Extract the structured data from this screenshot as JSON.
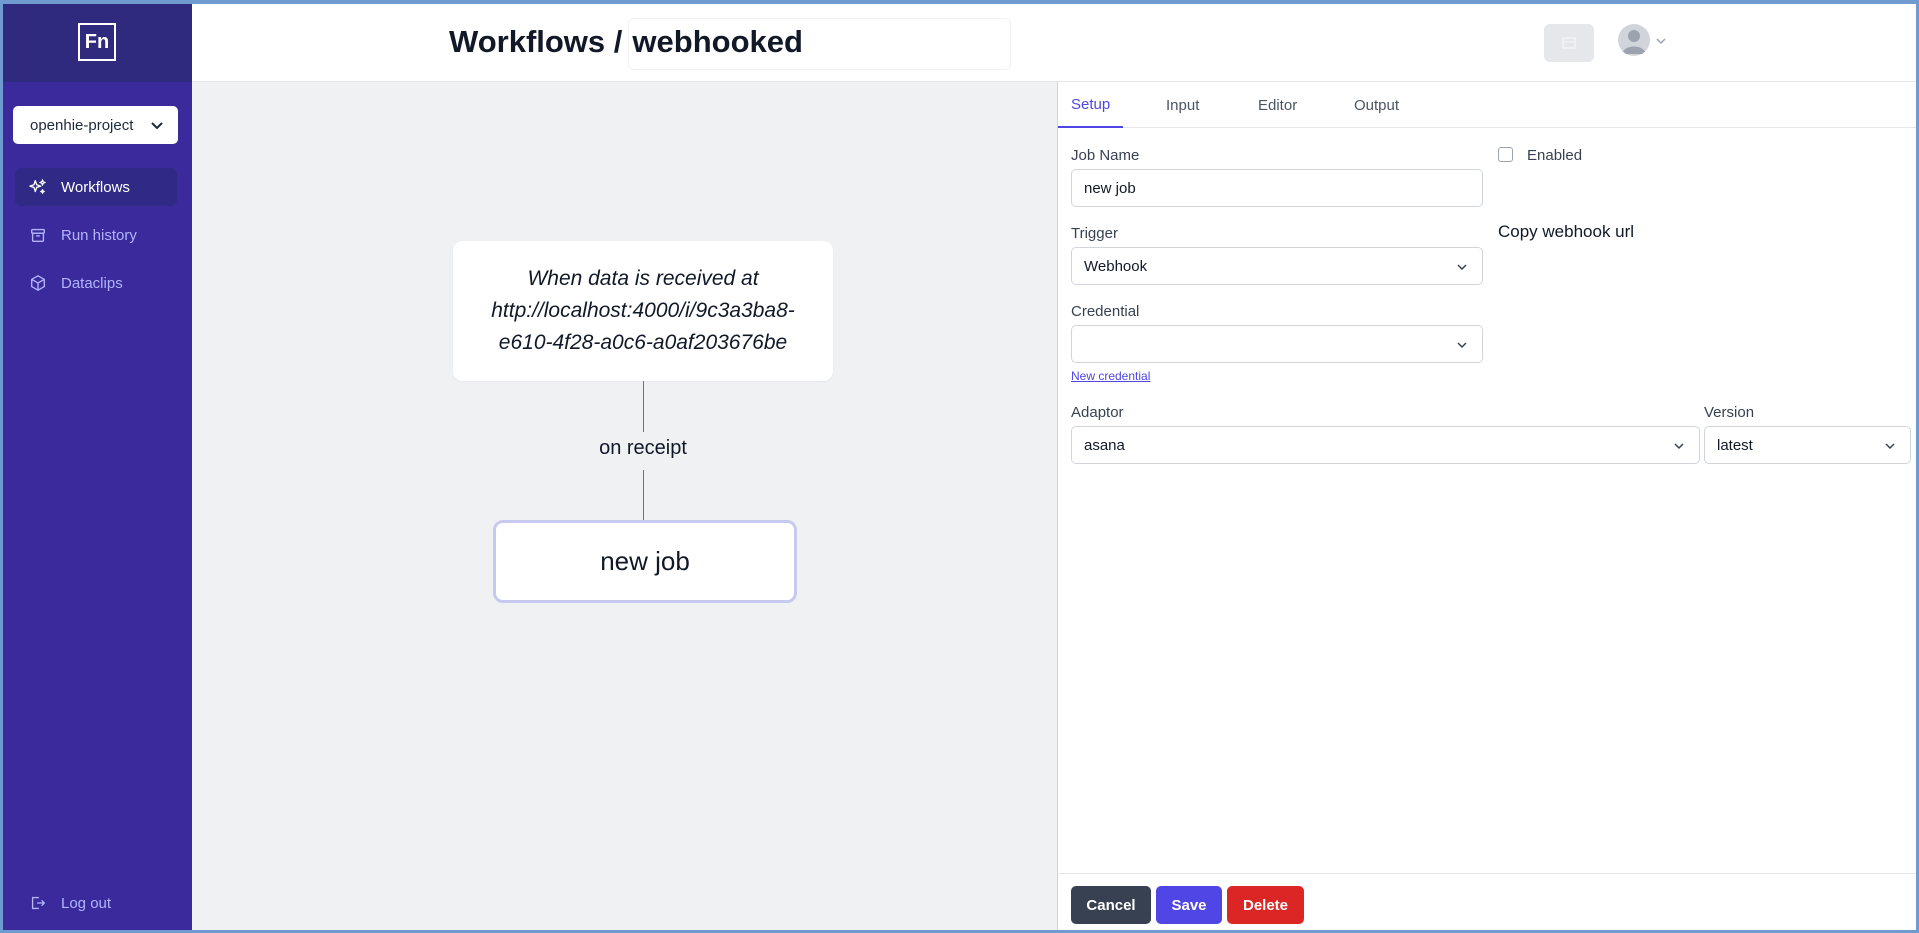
{
  "sidebar": {
    "logo": "Fn",
    "project": "openhie-project",
    "items": [
      {
        "label": "Workflows"
      },
      {
        "label": "Run history"
      },
      {
        "label": "Dataclips"
      }
    ],
    "logout": "Log out"
  },
  "header": {
    "breadcrumb": "Workflows /",
    "workflow_name": "webhooked"
  },
  "canvas": {
    "trigger_text": "When data is received at http://localhost:4000/i/9c3a3ba8-e610-4f28-a0c6-a0af203676be",
    "edge_label": "on receipt",
    "job_node": "new job"
  },
  "panel": {
    "tabs": [
      "Setup",
      "Input",
      "Editor",
      "Output"
    ],
    "active_tab": "Setup",
    "job_name_label": "Job Name",
    "job_name_value": "new job",
    "enabled_label": "Enabled",
    "enabled": false,
    "trigger_label": "Trigger",
    "trigger_value": "Webhook",
    "copy_webhook": "Copy webhook url",
    "credential_label": "Credential",
    "credential_value": "",
    "new_credential": "New credential",
    "adaptor_label": "Adaptor",
    "adaptor_value": "asana",
    "version_label": "Version",
    "version_value": "latest",
    "cancel": "Cancel",
    "save": "Save",
    "delete": "Delete"
  },
  "colors": {
    "sidebar": "#3b2a9c",
    "accent": "#4f46e5",
    "danger": "#dc2626",
    "neutral_button": "#374151"
  }
}
